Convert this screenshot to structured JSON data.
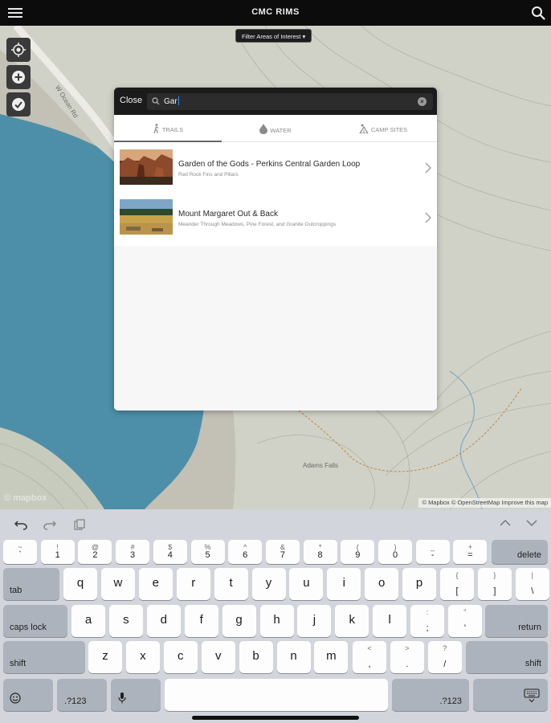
{
  "header": {
    "title": "CMC RIMS"
  },
  "map": {
    "filter_label": "Filter Areas of Interest ▾",
    "road_label": "W Ocean Rd",
    "place_label": "Adams Falls",
    "logo_text": "© mapbox",
    "attribution": "© Mapbox © OpenStreetMap  Improve this map",
    "colors": {
      "terrain": "#d1d2c7",
      "water": "#4d8fa8",
      "lake_shore": "#bfbcb0"
    }
  },
  "search_modal": {
    "close_label": "Close",
    "query": "Gar",
    "tabs": [
      {
        "label": "TRAILS",
        "icon": "hiker-icon",
        "active": true
      },
      {
        "label": "WATER",
        "icon": "water-drop-icon",
        "active": false
      },
      {
        "label": "CAMP SITES",
        "icon": "campsite-icon",
        "active": false
      }
    ],
    "results": [
      {
        "title": "Garden of the Gods - Perkins Central Garden Loop",
        "subtitle": "Red Rock Fins and Pillars"
      },
      {
        "title": "Mount Margaret Out & Back",
        "subtitle": "Meander Through Meadows, Pine Forest, and Granite Outcroppings"
      }
    ]
  },
  "keyboard": {
    "row1": [
      {
        "top": "~",
        "bottom": "`"
      },
      {
        "top": "!",
        "bottom": "1"
      },
      {
        "top": "@",
        "bottom": "2"
      },
      {
        "top": "#",
        "bottom": "3"
      },
      {
        "top": "$",
        "bottom": "4"
      },
      {
        "top": "%",
        "bottom": "5"
      },
      {
        "top": "^",
        "bottom": "6"
      },
      {
        "top": "&",
        "bottom": "7"
      },
      {
        "top": "*",
        "bottom": "8"
      },
      {
        "top": "(",
        "bottom": "9"
      },
      {
        "top": ")",
        "bottom": "0"
      },
      {
        "top": "_",
        "bottom": "-"
      },
      {
        "top": "+",
        "bottom": "="
      }
    ],
    "delete_label": "delete",
    "tab_label": "tab",
    "row2": [
      "q",
      "w",
      "e",
      "r",
      "t",
      "y",
      "u",
      "i",
      "o",
      "p"
    ],
    "row2_sym": [
      {
        "top": "{",
        "bottom": "["
      },
      {
        "top": "}",
        "bottom": "]"
      },
      {
        "top": "|",
        "bottom": "\\"
      }
    ],
    "caps_label": "caps lock",
    "row3": [
      "a",
      "s",
      "d",
      "f",
      "g",
      "h",
      "j",
      "k",
      "l"
    ],
    "row3_sym": [
      {
        "top": ":",
        "bottom": ";"
      },
      {
        "top": "\"",
        "bottom": "'"
      }
    ],
    "return_label": "return",
    "shift_label": "shift",
    "row4": [
      "z",
      "x",
      "c",
      "v",
      "b",
      "n",
      "m"
    ],
    "row4_sym": [
      {
        "top": "<",
        "bottom": ","
      },
      {
        "top": ">",
        "bottom": "."
      },
      {
        "top": "?",
        "bottom": "/"
      }
    ],
    "numbers_label": ".?123"
  }
}
